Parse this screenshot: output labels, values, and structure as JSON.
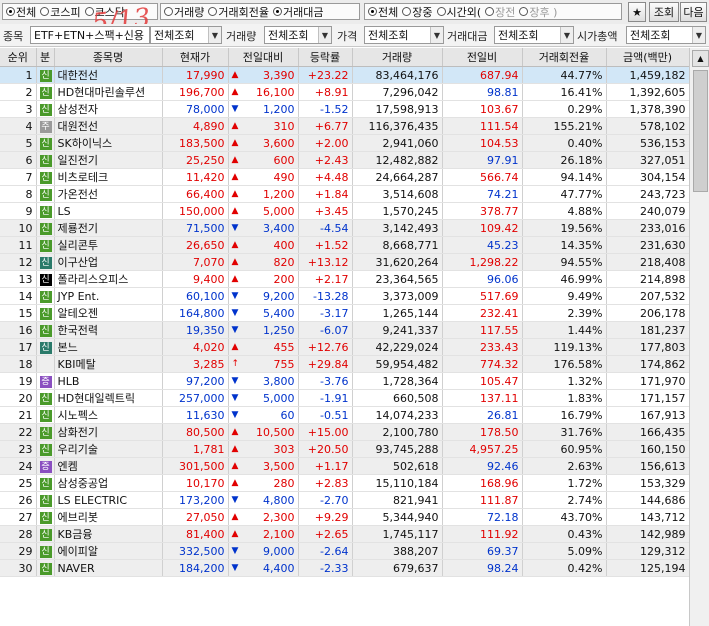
{
  "market_group": {
    "options": [
      {
        "label": "전체",
        "checked": true,
        "dim": false
      },
      {
        "label": "코스피",
        "checked": false,
        "dim": false
      },
      {
        "label": "코스닥",
        "checked": false,
        "dim": false
      }
    ]
  },
  "rank_group": {
    "options": [
      {
        "label": "거래량",
        "checked": false,
        "dim": false
      },
      {
        "label": "거래회전율",
        "checked": false,
        "dim": false
      },
      {
        "label": "거래대금",
        "checked": true,
        "dim": false
      }
    ]
  },
  "time_group": {
    "options": [
      {
        "label": "전체",
        "checked": true,
        "dim": false
      },
      {
        "label": "장중",
        "checked": false,
        "dim": false
      },
      {
        "label": "시간외(",
        "checked": false,
        "dim": false
      },
      {
        "label": "장전",
        "checked": false,
        "dim": true
      },
      {
        "label": "장후 )",
        "checked": false,
        "dim": true
      }
    ]
  },
  "toolbar": {
    "pin_icon": "pin-icon",
    "search_label": "조회",
    "next_label": "다음"
  },
  "filters": {
    "stock_label": "종목",
    "stock_value": "ETF+ETN+스팩+신용",
    "credit_label": "신용",
    "credit_value": "전체조회",
    "volume_label": "거래량",
    "volume_value": "전체조회",
    "price_label": "가격",
    "price_value": "전체조회",
    "amount_label": "거래대금",
    "amount_value": "전체조회",
    "mcap_label": "시가총액",
    "mcap_value": "전체조회"
  },
  "annotation": "5/13",
  "columns": [
    "순위",
    "분",
    "종목명",
    "현재가",
    "전일대비",
    "등락률",
    "거래량",
    "전일비",
    "거래회전율",
    "금액(백만)"
  ],
  "badge_colors": {
    "신": "#4a9a2a",
    "주": "#9a9a9a",
    "증": "#8a4fc0",
    "신B": "#2a7a6a",
    "신K": "#000000"
  },
  "rows": [
    {
      "rank": "1",
      "badge": "신",
      "name": "대한전선",
      "price": "17,990",
      "dir": "up",
      "change": "3,390",
      "rate": "+23.22",
      "volume": "83,464,176",
      "prev": "687.94",
      "turnover": "44.77%",
      "amount": "1,459,182",
      "style": "sel"
    },
    {
      "rank": "2",
      "badge": "신",
      "name": "HD현대마린솔루션",
      "price": "196,700",
      "dir": "up",
      "change": "16,100",
      "rate": "+8.91",
      "volume": "7,296,042",
      "prev": "98.81",
      "turnover": "16.41%",
      "amount": "1,392,605",
      "style": ""
    },
    {
      "rank": "3",
      "badge": "신",
      "name": "삼성전자",
      "price": "78,000",
      "dir": "down",
      "change": "1,200",
      "rate": "-1.52",
      "volume": "17,598,913",
      "prev": "103.67",
      "turnover": "0.29%",
      "amount": "1,378,390",
      "style": ""
    },
    {
      "rank": "4",
      "badge": "주",
      "name": "대원전선",
      "price": "4,890",
      "dir": "up",
      "change": "310",
      "rate": "+6.77",
      "volume": "116,376,435",
      "prev": "111.54",
      "turnover": "155.21%",
      "amount": "578,102",
      "style": "grey"
    },
    {
      "rank": "5",
      "badge": "신",
      "name": "SK하이닉스",
      "price": "183,500",
      "dir": "up",
      "change": "3,600",
      "rate": "+2.00",
      "volume": "2,941,060",
      "prev": "104.53",
      "turnover": "0.40%",
      "amount": "536,153",
      "style": "grey"
    },
    {
      "rank": "6",
      "badge": "신",
      "name": "일진전기",
      "price": "25,250",
      "dir": "up",
      "change": "600",
      "rate": "+2.43",
      "volume": "12,482,882",
      "prev": "97.91",
      "turnover": "26.18%",
      "amount": "327,051",
      "style": "grey"
    },
    {
      "rank": "7",
      "badge": "신",
      "name": "비츠로테크",
      "price": "11,420",
      "dir": "up",
      "change": "490",
      "rate": "+4.48",
      "volume": "24,664,287",
      "prev": "566.74",
      "turnover": "94.14%",
      "amount": "304,154",
      "style": ""
    },
    {
      "rank": "8",
      "badge": "신",
      "name": "가온전선",
      "price": "66,400",
      "dir": "up",
      "change": "1,200",
      "rate": "+1.84",
      "volume": "3,514,608",
      "prev": "74.21",
      "turnover": "47.77%",
      "amount": "243,723",
      "style": ""
    },
    {
      "rank": "9",
      "badge": "신",
      "name": "LS",
      "price": "150,000",
      "dir": "up",
      "change": "5,000",
      "rate": "+3.45",
      "volume": "1,570,245",
      "prev": "378.77",
      "turnover": "4.88%",
      "amount": "240,079",
      "style": ""
    },
    {
      "rank": "10",
      "badge": "신",
      "name": "제룡전기",
      "price": "71,500",
      "dir": "down",
      "change": "3,400",
      "rate": "-4.54",
      "volume": "3,142,493",
      "prev": "109.42",
      "turnover": "19.56%",
      "amount": "233,016",
      "style": "grey"
    },
    {
      "rank": "11",
      "badge": "신",
      "name": "실리콘투",
      "price": "26,650",
      "dir": "up",
      "change": "400",
      "rate": "+1.52",
      "volume": "8,668,771",
      "prev": "45.23",
      "turnover": "14.35%",
      "amount": "231,630",
      "style": "grey"
    },
    {
      "rank": "12",
      "badge": "신B",
      "name": "이구산업",
      "price": "7,070",
      "dir": "up",
      "change": "820",
      "rate": "+13.12",
      "volume": "31,620,264",
      "prev": "1,298.22",
      "turnover": "94.55%",
      "amount": "218,408",
      "style": "grey"
    },
    {
      "rank": "13",
      "badge": "신K",
      "name": "폴라리스오피스",
      "price": "9,400",
      "dir": "up",
      "change": "200",
      "rate": "+2.17",
      "volume": "23,364,565",
      "prev": "96.06",
      "turnover": "46.99%",
      "amount": "214,898",
      "style": ""
    },
    {
      "rank": "14",
      "badge": "신",
      "name": "JYP Ent.",
      "price": "60,100",
      "dir": "down",
      "change": "9,200",
      "rate": "-13.28",
      "volume": "3,373,009",
      "prev": "517.69",
      "turnover": "9.49%",
      "amount": "207,532",
      "style": ""
    },
    {
      "rank": "15",
      "badge": "신",
      "name": "알테오젠",
      "price": "164,800",
      "dir": "down",
      "change": "5,400",
      "rate": "-3.17",
      "volume": "1,265,144",
      "prev": "232.41",
      "turnover": "2.39%",
      "amount": "206,178",
      "style": ""
    },
    {
      "rank": "16",
      "badge": "신",
      "name": "한국전력",
      "price": "19,350",
      "dir": "down",
      "change": "1,250",
      "rate": "-6.07",
      "volume": "9,241,337",
      "prev": "117.55",
      "turnover": "1.44%",
      "amount": "181,237",
      "style": "grey"
    },
    {
      "rank": "17",
      "badge": "신B",
      "name": "본느",
      "price": "4,020",
      "dir": "up",
      "change": "455",
      "rate": "+12.76",
      "volume": "42,229,024",
      "prev": "233.43",
      "turnover": "119.13%",
      "amount": "177,803",
      "style": "grey"
    },
    {
      "rank": "18",
      "badge": "",
      "name": "KBI메탈",
      "price": "3,285",
      "dir": "upper",
      "change": "755",
      "rate": "+29.84",
      "volume": "59,954,482",
      "prev": "774.32",
      "turnover": "176.58%",
      "amount": "174,862",
      "style": "grey"
    },
    {
      "rank": "19",
      "badge": "증",
      "name": "HLB",
      "price": "97,200",
      "dir": "down",
      "change": "3,800",
      "rate": "-3.76",
      "volume": "1,728,364",
      "prev": "105.47",
      "turnover": "1.32%",
      "amount": "171,970",
      "style": ""
    },
    {
      "rank": "20",
      "badge": "신",
      "name": "HD현대일렉트릭",
      "price": "257,000",
      "dir": "down",
      "change": "5,000",
      "rate": "-1.91",
      "volume": "660,508",
      "prev": "137.11",
      "turnover": "1.83%",
      "amount": "171,157",
      "style": ""
    },
    {
      "rank": "21",
      "badge": "신",
      "name": "시노펙스",
      "price": "11,630",
      "dir": "down",
      "change": "60",
      "rate": "-0.51",
      "volume": "14,074,233",
      "prev": "26.81",
      "turnover": "16.79%",
      "amount": "167,913",
      "style": ""
    },
    {
      "rank": "22",
      "badge": "신",
      "name": "삼화전기",
      "price": "80,500",
      "dir": "up",
      "change": "10,500",
      "rate": "+15.00",
      "volume": "2,100,780",
      "prev": "178.50",
      "turnover": "31.76%",
      "amount": "166,435",
      "style": "grey"
    },
    {
      "rank": "23",
      "badge": "신",
      "name": "우리기술",
      "price": "1,781",
      "dir": "up",
      "change": "303",
      "rate": "+20.50",
      "volume": "93,745,288",
      "prev": "4,957.25",
      "turnover": "60.95%",
      "amount": "160,150",
      "style": "grey"
    },
    {
      "rank": "24",
      "badge": "증",
      "name": "엔켐",
      "price": "301,500",
      "dir": "up",
      "change": "3,500",
      "rate": "+1.17",
      "volume": "502,618",
      "prev": "92.46",
      "turnover": "2.63%",
      "amount": "156,613",
      "style": "grey"
    },
    {
      "rank": "25",
      "badge": "신",
      "name": "삼성중공업",
      "price": "10,170",
      "dir": "up",
      "change": "280",
      "rate": "+2.83",
      "volume": "15,110,184",
      "prev": "168.96",
      "turnover": "1.72%",
      "amount": "153,329",
      "style": ""
    },
    {
      "rank": "26",
      "badge": "신",
      "name": "LS ELECTRIC",
      "price": "173,200",
      "dir": "down",
      "change": "4,800",
      "rate": "-2.70",
      "volume": "821,941",
      "prev": "111.87",
      "turnover": "2.74%",
      "amount": "144,686",
      "style": ""
    },
    {
      "rank": "27",
      "badge": "신",
      "name": "에브리봇",
      "price": "27,050",
      "dir": "up",
      "change": "2,300",
      "rate": "+9.29",
      "volume": "5,344,940",
      "prev": "72.18",
      "turnover": "43.70%",
      "amount": "143,712",
      "style": ""
    },
    {
      "rank": "28",
      "badge": "신",
      "name": "KB금융",
      "price": "81,400",
      "dir": "up",
      "change": "2,100",
      "rate": "+2.65",
      "volume": "1,745,117",
      "prev": "111.92",
      "turnover": "0.43%",
      "amount": "142,989",
      "style": "grey"
    },
    {
      "rank": "29",
      "badge": "신",
      "name": "에이피알",
      "price": "332,500",
      "dir": "down",
      "change": "9,000",
      "rate": "-2.64",
      "volume": "388,207",
      "prev": "69.37",
      "turnover": "5.09%",
      "amount": "129,312",
      "style": "grey"
    },
    {
      "rank": "30",
      "badge": "신",
      "name": "NAVER",
      "price": "184,200",
      "dir": "down",
      "change": "4,400",
      "rate": "-2.33",
      "volume": "679,637",
      "prev": "98.24",
      "turnover": "0.42%",
      "amount": "125,194",
      "style": "grey"
    }
  ]
}
